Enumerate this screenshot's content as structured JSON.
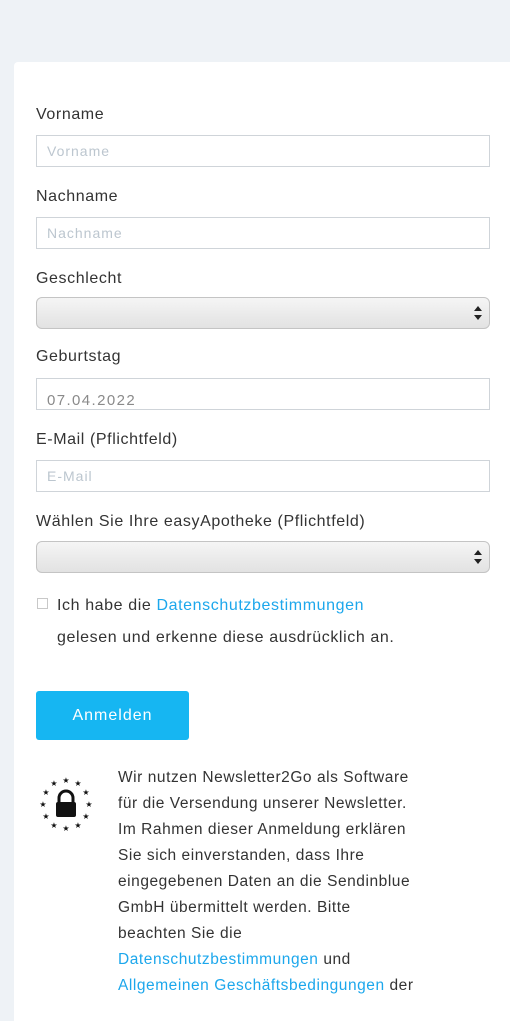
{
  "form": {
    "first_name": {
      "label": "Vorname",
      "placeholder": "Vorname",
      "value": ""
    },
    "last_name": {
      "label": "Nachname",
      "placeholder": "Nachname",
      "value": ""
    },
    "gender": {
      "label": "Geschlecht",
      "selected": ""
    },
    "birthday": {
      "label": "Geburtstag",
      "value": "07.04.2022"
    },
    "email": {
      "label": "E-Mail (Pflichtfeld)",
      "placeholder": "E-Mail",
      "value": ""
    },
    "pharmacy": {
      "label": "Wählen Sie Ihre easyApotheke (Pflichtfeld)",
      "selected": ""
    },
    "consent": {
      "checked": false,
      "text_before": "Ich habe die ",
      "link": "Datenschutzbestimmungen",
      "text_after": "gelesen und erkenne diese ausdrücklich an."
    },
    "submit_label": "Anmelden"
  },
  "info": {
    "lines": [
      "Wir nutzen Newsletter2Go als Software",
      "für die Versendung unserer Newsletter.",
      "Im Rahmen dieser Anmeldung erklären",
      "Sie sich einverstanden, dass Ihre",
      "eingegebenen Daten an die Sendinblue",
      "GmbH übermittelt werden. Bitte",
      "beachten Sie die"
    ],
    "privacy_link": "Datenschutzbestimmungen",
    "and_text": " und",
    "terms_link": "Allgemeinen Geschäftsbedingungen",
    "after_terms": " der"
  },
  "colors": {
    "page_background": "#eef2f6",
    "accent": "#16b6f2",
    "link": "#1ca7ec",
    "text": "#333333",
    "input_border": "#cfd4d9"
  },
  "icons": {
    "gdpr": "gdpr-lock-stars-icon",
    "select_arrows": "select-arrows-icon"
  }
}
